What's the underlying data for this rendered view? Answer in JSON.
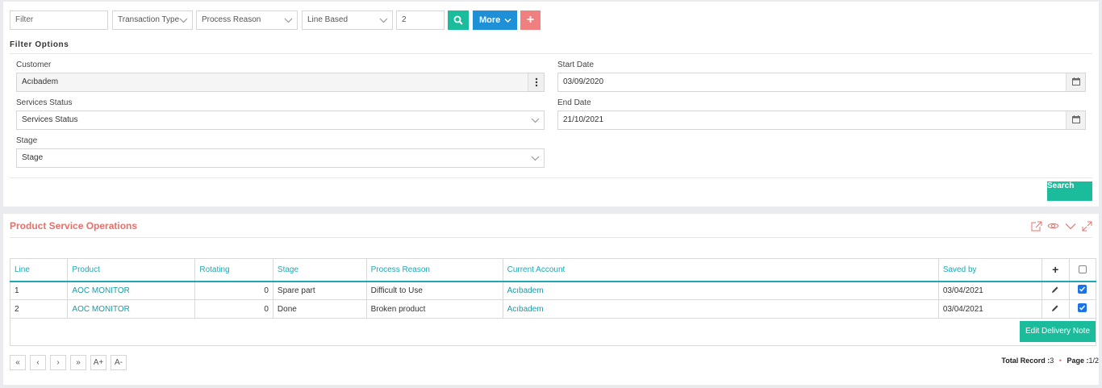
{
  "toolbar": {
    "filter_placeholder": "Filter",
    "transaction_type": "Transaction Type",
    "process_reason": "Process Reason",
    "line_based": "Line Based",
    "number_value": "2",
    "more_label": "More",
    "plus_label": "+"
  },
  "filter_options": {
    "title": "Filter Options",
    "customer_label": "Customer",
    "customer_value": "Acıbadem",
    "services_status_label": "Services Status",
    "services_status_value": "Services Status",
    "stage_label": "Stage",
    "stage_value": "Stage",
    "start_date_label": "Start Date",
    "start_date_value": "03/09/2020",
    "end_date_label": "End Date",
    "end_date_value": "21/10/2021",
    "search_label": "Search"
  },
  "operations": {
    "title": "Product Service Operations",
    "columns": [
      "Line",
      "Product",
      "Rotating",
      "Stage",
      "Process Reason",
      "Current Account",
      "Saved by"
    ],
    "add_label": "+",
    "rows": [
      {
        "line": "1",
        "product": "AOC MONITOR",
        "rotating": "0",
        "stage": "Spare part",
        "reason": "Difficult to Use",
        "account": "Acıbadem",
        "saved": "03/04/2021"
      },
      {
        "line": "2",
        "product": "AOC MONITOR",
        "rotating": "0",
        "stage": "Done",
        "reason": "Broken product",
        "account": "Acıbadem",
        "saved": "03/04/2021"
      }
    ],
    "edit_delivery_label": "Edit Delivery Note",
    "pagination": {
      "first": "«",
      "prev": "‹",
      "next": "›",
      "last": "»",
      "font_up": "A+",
      "font_down": "A-"
    },
    "total_record_label": "Total Record :",
    "total_record_value": "3",
    "page_label": "Page :",
    "page_value": "1/2"
  },
  "colors": {
    "teal": "#1abc9c",
    "blue": "#1e90d8",
    "red": "#f08080",
    "title_red": "#e8706b"
  }
}
